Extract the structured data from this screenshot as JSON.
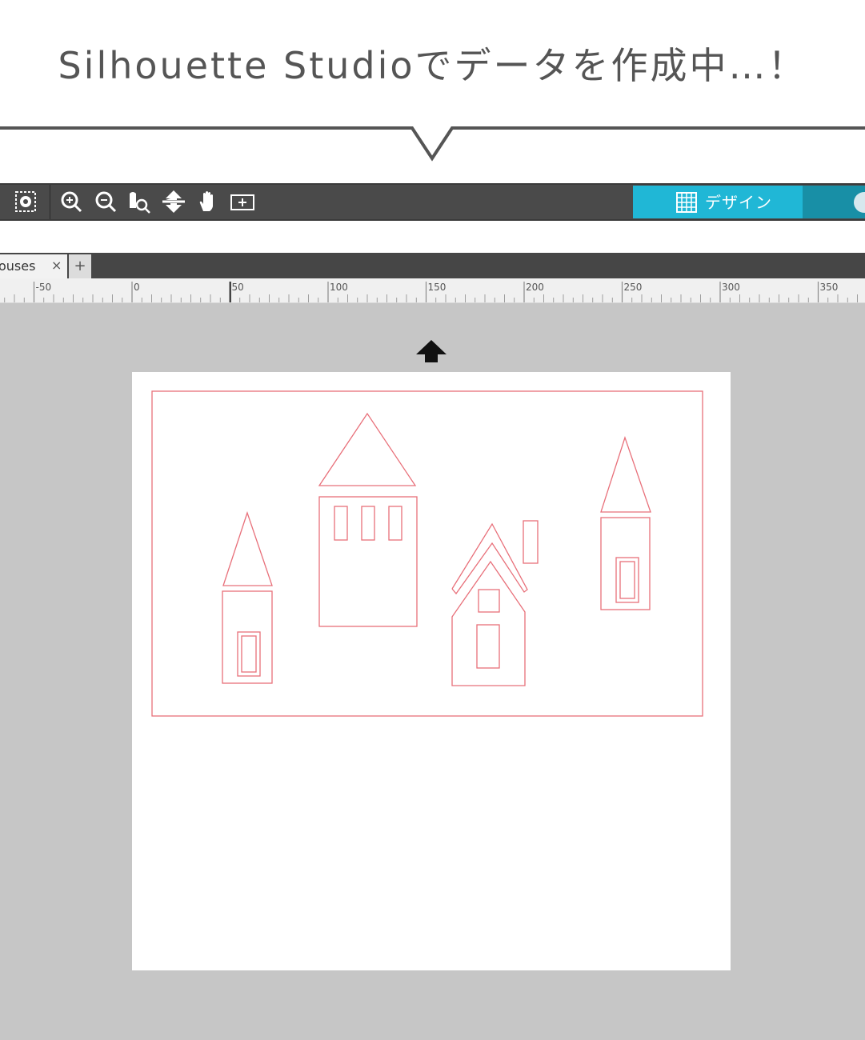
{
  "caption": "Silhouette Studioでデータを作成中…！",
  "toolbar": {
    "tools": [
      "select-all-icon",
      "zoom-in-icon",
      "zoom-out-icon",
      "zoom-selection-icon",
      "pan-move-icon",
      "hand-icon",
      "fit-to-page-icon"
    ],
    "design_tab_label": "デザイン",
    "design_tab_color": "#20b7d6",
    "store_tab_color": "#188fa6"
  },
  "tabs": {
    "document_name": "ouses",
    "close_symbol": "×",
    "add_symbol": "+"
  },
  "ruler": {
    "labels": [
      "-50",
      "0",
      "50",
      "100",
      "150",
      "200",
      "250",
      "300",
      "350"
    ]
  },
  "canvas": {
    "cut_line_color": "#e8707a",
    "workspace_color": "#c6c6c6",
    "page_color": "#ffffff",
    "design": [
      "border-rectangle",
      "house-left",
      "house-tall-center",
      "house-gabled",
      "chimney",
      "house-right"
    ]
  }
}
